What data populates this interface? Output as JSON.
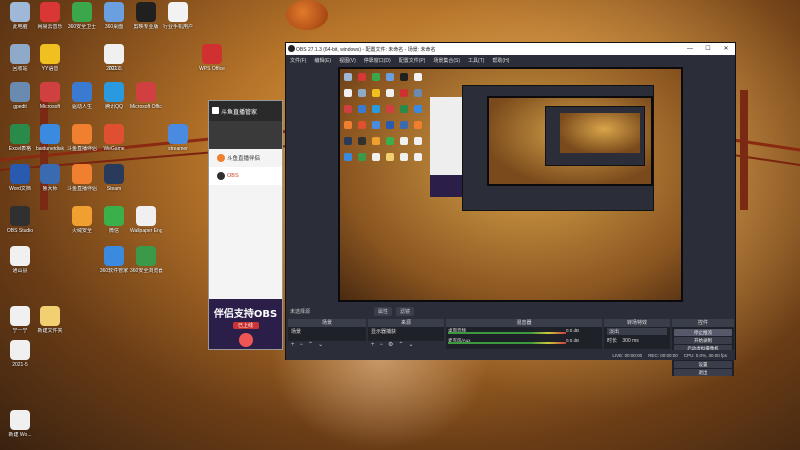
{
  "desktop": {
    "icons": [
      {
        "label": "此电脑",
        "color": "#9fb8d8"
      },
      {
        "label": "网易云音乐",
        "color": "#d93636"
      },
      {
        "label": "360安全卫士",
        "color": "#3aa84a"
      },
      {
        "label": "360桌面",
        "color": "#6aa0e0"
      },
      {
        "label": "剪映专业版",
        "color": "#202020"
      },
      {
        "label": "行业手机用户",
        "color": "#f2f2f2"
      },
      {
        "label": "2021",
        "color": "#f0f0f0"
      },
      {
        "label": "回收站",
        "color": "#8fa9c9"
      },
      {
        "label": "YY语音",
        "color": "#f0c020"
      },
      {
        "label": "2021-5",
        "color": "#f0f0f0"
      },
      {
        "label": "WPS Office",
        "color": "#d03030"
      },
      {
        "label": "gpedit",
        "color": "#6a8ab0"
      },
      {
        "label": "Microsoft",
        "color": "#d04040"
      },
      {
        "label": "驱动人生",
        "color": "#3a7ad0"
      },
      {
        "label": "腾讯QQ",
        "color": "#2a9ae0"
      },
      {
        "label": "Microsoft Office",
        "color": "#d04040"
      },
      {
        "label": "Excel表格",
        "color": "#2a8a4a"
      },
      {
        "label": "baidunetdisk",
        "color": "#3a8ae0"
      },
      {
        "label": "斗鱼直播伴侣",
        "color": "#f08030"
      },
      {
        "label": "WeGame",
        "color": "#e05030"
      },
      {
        "label": "streamer",
        "color": "#4a8ae0"
      },
      {
        "label": "Word文档",
        "color": "#2a5ab0"
      },
      {
        "label": "鲁大师",
        "color": "#3a6ab0"
      },
      {
        "label": "斗鱼直播伴侣",
        "color": "#f08030"
      },
      {
        "label": "Steam",
        "color": "#2a3a5a"
      },
      {
        "label": "OBS Studio",
        "color": "#303030"
      },
      {
        "label": "火绒安全",
        "color": "#f0a030"
      },
      {
        "label": "微信",
        "color": "#3ab04a"
      },
      {
        "label": "Wallpaper Engine",
        "color": "#f0f0f0"
      },
      {
        "label": "通山县",
        "color": "#f0f0f0"
      },
      {
        "label": "360软件管家",
        "color": "#3a8ae0"
      },
      {
        "label": "360安全浏览器",
        "color": "#3a9a4a"
      },
      {
        "label": "宁一宁",
        "color": "#f0f0f0"
      },
      {
        "label": "新建文件夹",
        "color": "#f0d070"
      },
      {
        "label": "2021-5",
        "color": "#f0f0f0"
      },
      {
        "label": "新建 Wo...",
        "color": "#f0f0f0"
      }
    ]
  },
  "douyu": {
    "title": "斗鱼直播管家",
    "items": [
      {
        "label": "斗鱼直播伴侣",
        "color": "#f08030"
      },
      {
        "label": "OBS",
        "color": "#303030"
      }
    ],
    "ad_text": "伴侣支持OBS",
    "ad_badge": "已上线"
  },
  "obs": {
    "title": "OBS 27.1.3 (64-bit, windows) - 配置文件: 未命名 - 场景: 未命名",
    "menu": [
      "文件(F)",
      "编辑(E)",
      "视图(V)",
      "停靠窗口(D)",
      "配置文件(P)",
      "场景集合(S)",
      "工具(T)",
      "帮助(H)"
    ],
    "scene_bar": {
      "label": "未选择源",
      "props": "属性",
      "filters": "滤镜"
    },
    "docks": {
      "scenes": {
        "title": "场景",
        "items": [
          "场景"
        ]
      },
      "sources": {
        "title": "来源",
        "items": [
          "显示器捕获"
        ]
      },
      "mixer": {
        "title": "混音器",
        "rows": [
          {
            "name": "桌面音频",
            "db": "0.0 dB"
          },
          {
            "name": "麦克风/Aux",
            "db": "0.0 dB"
          }
        ]
      },
      "transitions": {
        "title": "转场特效",
        "type": "淡出",
        "duration_label": "时长",
        "duration": "300 ms"
      },
      "controls": {
        "title": "控件",
        "buttons": [
          "停止推流",
          "开始录制",
          "启动虚拟摄像机",
          "工作室模式",
          "设置",
          "退出"
        ]
      }
    },
    "status": [
      "LIVE: 00:00:00",
      "REC: 00:00:00",
      "CPU: 0.0%, 30.00 fps"
    ]
  }
}
